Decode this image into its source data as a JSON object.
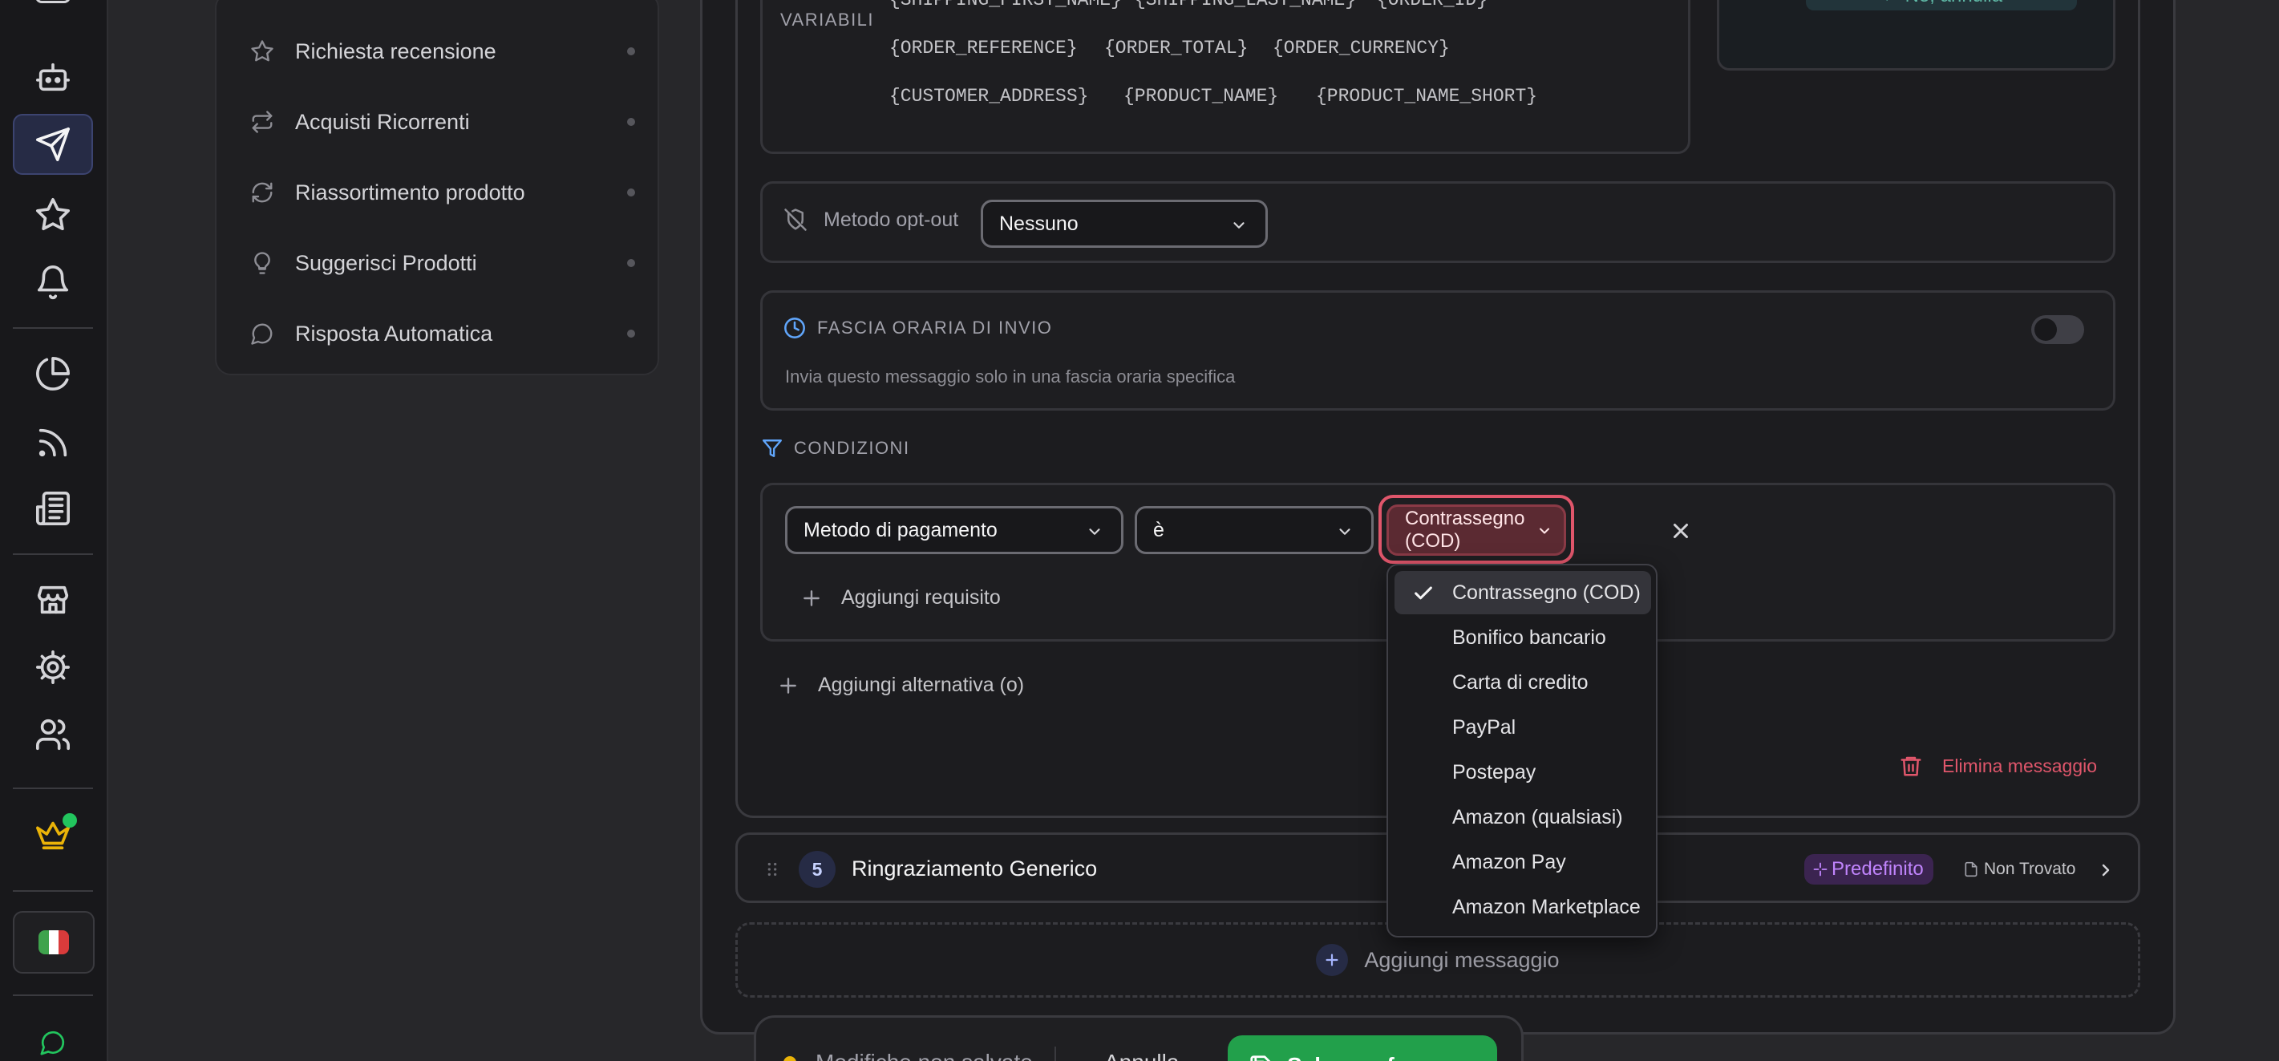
{
  "sidebar_rail": {
    "icons": [
      "bot-icon",
      "send-icon",
      "star-icon",
      "bell-icon",
      "pie-chart-icon",
      "rss-icon",
      "newspaper-icon",
      "store-icon",
      "settings-icon",
      "users-icon",
      "crown-icon",
      "message-icon"
    ],
    "active": "send-icon",
    "language_flag_colors": [
      "#3fa34d",
      "#ffffff",
      "#d93b3b"
    ],
    "crown_color": "#eab308",
    "online_dot_color": "#22c55e"
  },
  "subnav": {
    "items": [
      {
        "label": "Richiesta recensione",
        "icon": "star-icon"
      },
      {
        "label": "Acquisti Ricorrenti",
        "icon": "repeat-icon"
      },
      {
        "label": "Riassortimento prodotto",
        "icon": "refresh-icon"
      },
      {
        "label": "Suggerisci Prodotti",
        "icon": "lightbulb-icon"
      },
      {
        "label": "Risposta Automatica",
        "icon": "message-circle-icon"
      }
    ]
  },
  "editor": {
    "variables_label": "VARIABILI",
    "variables": [
      [
        "{SHIPPING_FIRST_NAME}",
        "{SHIPPING_LAST_NAME}",
        "{ORDER_ID}"
      ],
      [
        "{ORDER_REFERENCE}",
        "{ORDER_TOTAL}",
        "{ORDER_CURRENCY}"
      ],
      [
        "{CUSTOMER_ADDRESS}",
        "{PRODUCT_NAME}",
        "{PRODUCT_NAME_SHORT}"
      ]
    ],
    "cancel_reply_label": "← No, annulla",
    "optout": {
      "label": "Metodo opt-out",
      "value": "Nessuno"
    },
    "time_window": {
      "title": "FASCIA ORARIA DI INVIO",
      "description": "Invia questo messaggio solo in una fascia oraria specifica",
      "enabled": false
    },
    "conditions": {
      "title": "CONDIZIONI",
      "field": "Metodo di pagamento",
      "operator": "è",
      "value": "Contrassegno (COD)",
      "add_requirement": "Aggiungi requisito",
      "add_alternative": "Aggiungi alternativa (o)"
    },
    "delete_message": "Elimina messaggio",
    "accent_color": "#e0566b"
  },
  "dropdown": {
    "options": [
      "Contrassegno (COD)",
      "Bonifico bancario",
      "Carta di credito",
      "PayPal",
      "Postepay",
      "Amazon (qualsiasi)",
      "Amazon Pay",
      "Amazon Marketplace"
    ],
    "selected": "Contrassegno (COD)"
  },
  "message_row": {
    "number": "5",
    "title": "Ringraziamento Generico",
    "badge": "Predefinito",
    "status": "Non Trovato"
  },
  "add_message": "Aggiungi messaggio",
  "footer_bar": {
    "unsaved": "Modifiche non salvate",
    "cancel": "Annulla",
    "save": "Salva preferenze",
    "save_color": "#22a04b"
  }
}
